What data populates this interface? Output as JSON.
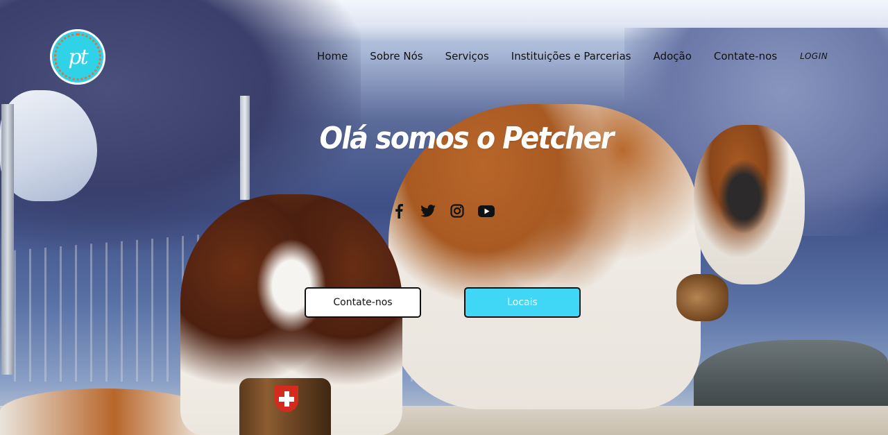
{
  "brand": {
    "logo_text": "pt",
    "logo_color": "#2fd2e6"
  },
  "nav": {
    "items": [
      {
        "label": "Home"
      },
      {
        "label": "Sobre Nós"
      },
      {
        "label": "Serviços"
      },
      {
        "label": "Instituições e Parcerias"
      },
      {
        "label": "Adoção"
      },
      {
        "label": "Contate-nos"
      }
    ],
    "login_label": "LOGIN"
  },
  "hero": {
    "headline": "Olá somos o Petcher",
    "socials": [
      {
        "icon": "facebook-icon"
      },
      {
        "icon": "twitter-icon"
      },
      {
        "icon": "instagram-icon"
      },
      {
        "icon": "youtube-icon"
      }
    ],
    "buttons": {
      "contact_label": "Contate-nos",
      "locais_label": "Locais"
    },
    "accent_color": "#3fd7f5"
  }
}
